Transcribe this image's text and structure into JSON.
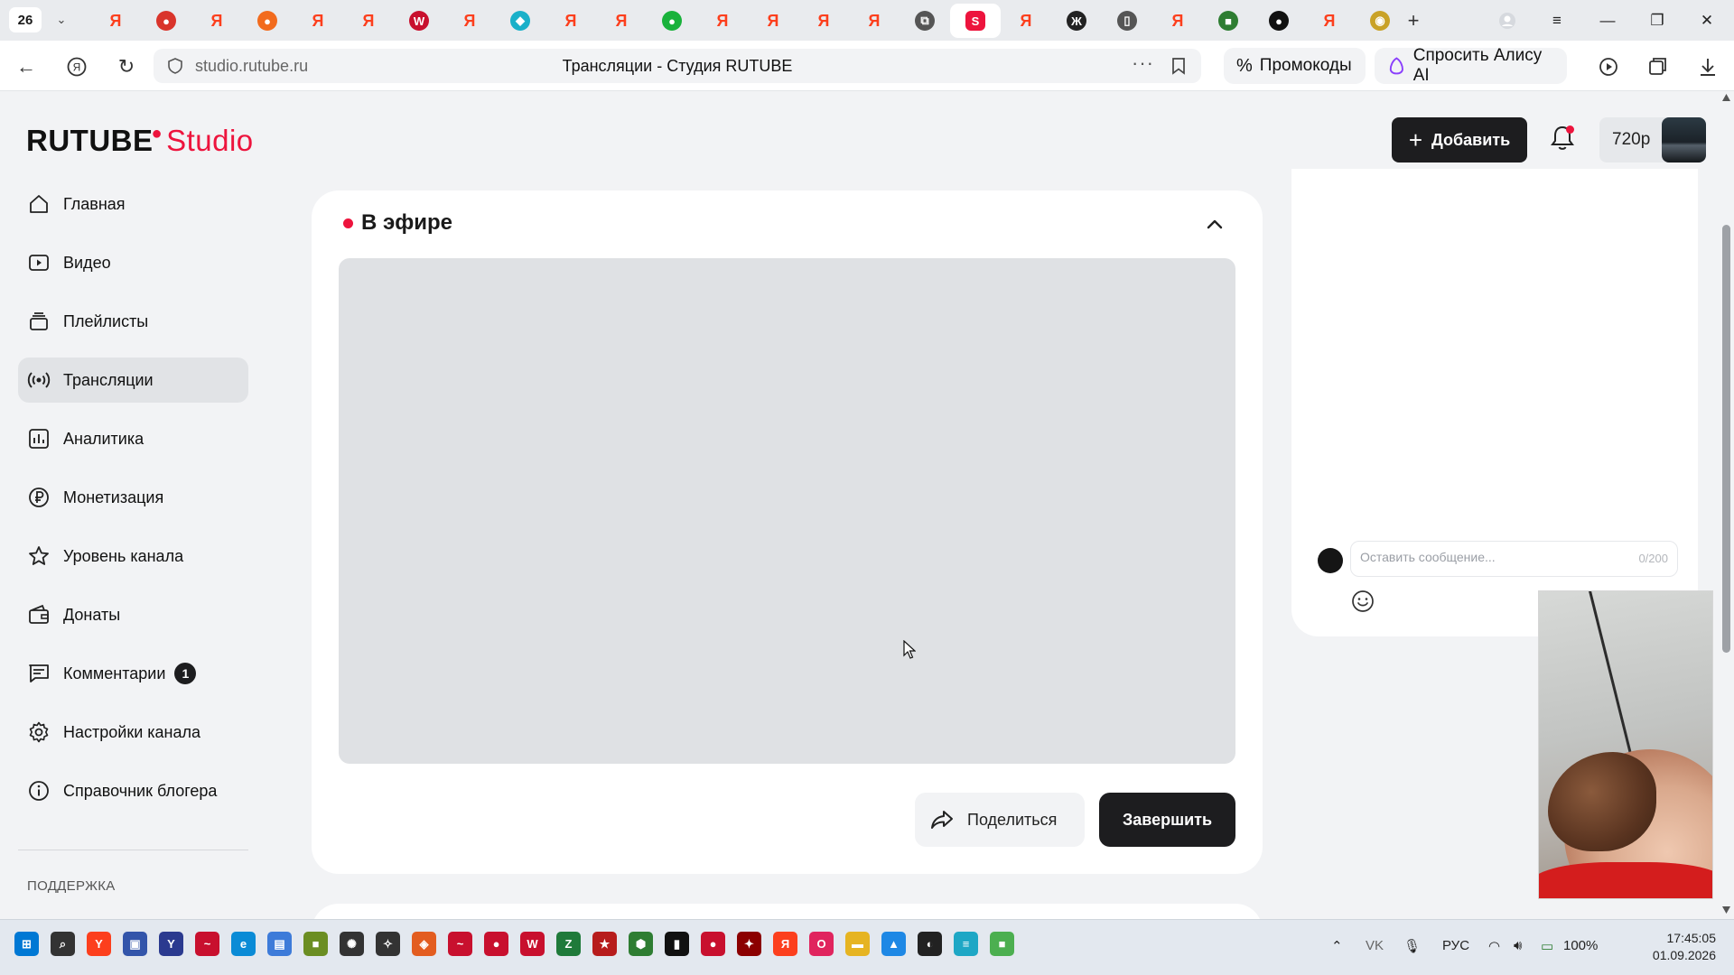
{
  "browser": {
    "tab_count": "26",
    "tabs": [
      {
        "icon": "yandex-icon",
        "color": "#fc3f1d",
        "glyph": "Я"
      },
      {
        "icon": "app-icon",
        "color": "#d9342b",
        "glyph": "●"
      },
      {
        "icon": "yandex-icon",
        "color": "#fc3f1d",
        "glyph": "Я"
      },
      {
        "icon": "app-icon",
        "color": "#f26b1d",
        "glyph": "●"
      },
      {
        "icon": "yandex-icon",
        "color": "#fc3f1d",
        "glyph": "Я"
      },
      {
        "icon": "yandex-icon",
        "color": "#fc3f1d",
        "glyph": "Я"
      },
      {
        "icon": "w-icon",
        "color": "#c8102e",
        "glyph": "W"
      },
      {
        "icon": "yandex-icon",
        "color": "#fc3f1d",
        "glyph": "Я"
      },
      {
        "icon": "shield-icon",
        "color": "#19b0c9",
        "glyph": "◆"
      },
      {
        "icon": "yandex-icon",
        "color": "#fc3f1d",
        "glyph": "Я"
      },
      {
        "icon": "yandex-icon",
        "color": "#fc3f1d",
        "glyph": "Я"
      },
      {
        "icon": "app-icon",
        "color": "#19b23b",
        "glyph": "●"
      },
      {
        "icon": "yandex-icon",
        "color": "#fc3f1d",
        "glyph": "Я"
      },
      {
        "icon": "yandex-icon",
        "color": "#fc3f1d",
        "glyph": "Я"
      },
      {
        "icon": "yandex-icon",
        "color": "#fc3f1d",
        "glyph": "Я"
      },
      {
        "icon": "yandex-icon",
        "color": "#fc3f1d",
        "glyph": "Я"
      },
      {
        "icon": "window-icon",
        "color": "#555555",
        "glyph": "⧉"
      },
      {
        "icon": "rutube-studio-icon",
        "color": "#ed143d",
        "glyph": "S",
        "active": true
      },
      {
        "icon": "yandex-icon",
        "color": "#fc3f1d",
        "glyph": "Я"
      },
      {
        "icon": "app-icon",
        "color": "#222222",
        "glyph": "Ж"
      },
      {
        "icon": "document-icon",
        "color": "#555555",
        "glyph": "▯"
      },
      {
        "icon": "yandex-icon",
        "color": "#fc3f1d",
        "glyph": "Я"
      },
      {
        "icon": "app-icon",
        "color": "#2e7d32",
        "glyph": "■"
      },
      {
        "icon": "app-icon",
        "color": "#111111",
        "glyph": "●"
      },
      {
        "icon": "yandex-icon",
        "color": "#fc3f1d",
        "glyph": "Я"
      },
      {
        "icon": "app-icon",
        "color": "#c9a227",
        "glyph": "◉"
      }
    ],
    "url": "studio.rutube.ru",
    "title": "Трансляции - Студия RUTUBE",
    "promo_label": "Промокоды",
    "alice_label": "Спросить Алису AI"
  },
  "studio": {
    "logo_main": "RUTUBE",
    "logo_sub": "Studio",
    "add_label": "Добавить",
    "quality": "720p",
    "accent": "#ed143d"
  },
  "sidebar": {
    "items": [
      {
        "label": "Главная",
        "icon": "home-icon"
      },
      {
        "label": "Видео",
        "icon": "video-icon"
      },
      {
        "label": "Плейлисты",
        "icon": "playlist-icon"
      },
      {
        "label": "Трансляции",
        "icon": "broadcast-icon",
        "active": true
      },
      {
        "label": "Аналитика",
        "icon": "analytics-icon"
      },
      {
        "label": "Монетизация",
        "icon": "ruble-icon"
      },
      {
        "label": "Уровень канала",
        "icon": "star-icon"
      },
      {
        "label": "Донаты",
        "icon": "wallet-icon"
      },
      {
        "label": "Комментарии",
        "icon": "comment-icon",
        "badge": "1"
      },
      {
        "label": "Настройки канала",
        "icon": "gear-icon"
      },
      {
        "label": "Справочник блогера",
        "icon": "info-icon"
      }
    ],
    "section_label": "ПОДДЕРЖКА"
  },
  "live": {
    "title": "В эфире",
    "share_label": "Поделиться",
    "end_label": "Завершить"
  },
  "chat": {
    "placeholder": "Оставить сообщение...",
    "counter": "0/200"
  },
  "taskbar": {
    "apps": [
      {
        "name": "start-icon",
        "color": "#0078d4",
        "glyph": "⊞"
      },
      {
        "name": "search-icon",
        "color": "#333333",
        "glyph": "⌕"
      },
      {
        "name": "yandex-browser-icon",
        "color": "#fc3f1d",
        "glyph": "Y"
      },
      {
        "name": "save-icon",
        "color": "#3355aa",
        "glyph": "▣"
      },
      {
        "name": "app-icon",
        "color": "#2b3a8f",
        "glyph": "Y"
      },
      {
        "name": "app-icon",
        "color": "#c8102e",
        "glyph": "~"
      },
      {
        "name": "edge-icon",
        "color": "#0a8bd6",
        "glyph": "e"
      },
      {
        "name": "app-icon",
        "color": "#3d7bd9",
        "glyph": "▤"
      },
      {
        "name": "minecraft-icon",
        "color": "#6b8e23",
        "glyph": "■"
      },
      {
        "name": "chatgpt-icon",
        "color": "#333333",
        "glyph": "✺"
      },
      {
        "name": "app-icon",
        "color": "#333333",
        "glyph": "✧"
      },
      {
        "name": "app-icon",
        "color": "#e35d20",
        "glyph": "◈"
      },
      {
        "name": "app-icon",
        "color": "#c8102e",
        "glyph": "~"
      },
      {
        "name": "app-icon",
        "color": "#c8102e",
        "glyph": "●"
      },
      {
        "name": "app-icon",
        "color": "#c8102e",
        "glyph": "W"
      },
      {
        "name": "app-icon",
        "color": "#1f7a3a",
        "glyph": "Z"
      },
      {
        "name": "app-icon",
        "color": "#b71c1c",
        "glyph": "★"
      },
      {
        "name": "app-icon",
        "color": "#2e7d32",
        "glyph": "⬢"
      },
      {
        "name": "app-icon",
        "color": "#111111",
        "glyph": "▮"
      },
      {
        "name": "app-icon",
        "color": "#c8102e",
        "glyph": "●"
      },
      {
        "name": "app-icon",
        "color": "#8b0000",
        "glyph": "✦"
      },
      {
        "name": "app-icon",
        "color": "#fc3f1d",
        "glyph": "Я"
      },
      {
        "name": "opera-icon",
        "color": "#e0245e",
        "glyph": "O"
      },
      {
        "name": "folder-icon",
        "color": "#e6b422",
        "glyph": "▬"
      },
      {
        "name": "app-icon",
        "color": "#1e88e5",
        "glyph": "▲"
      },
      {
        "name": "app-icon",
        "color": "#222222",
        "glyph": "◐"
      },
      {
        "name": "notepad-icon",
        "color": "#1ea7c5",
        "glyph": "≡"
      },
      {
        "name": "minecraft-icon",
        "color": "#4caf50",
        "glyph": "■"
      }
    ],
    "lang": "РУС",
    "battery": "100%",
    "time": "17:45:05",
    "date": "01.09.2026"
  }
}
